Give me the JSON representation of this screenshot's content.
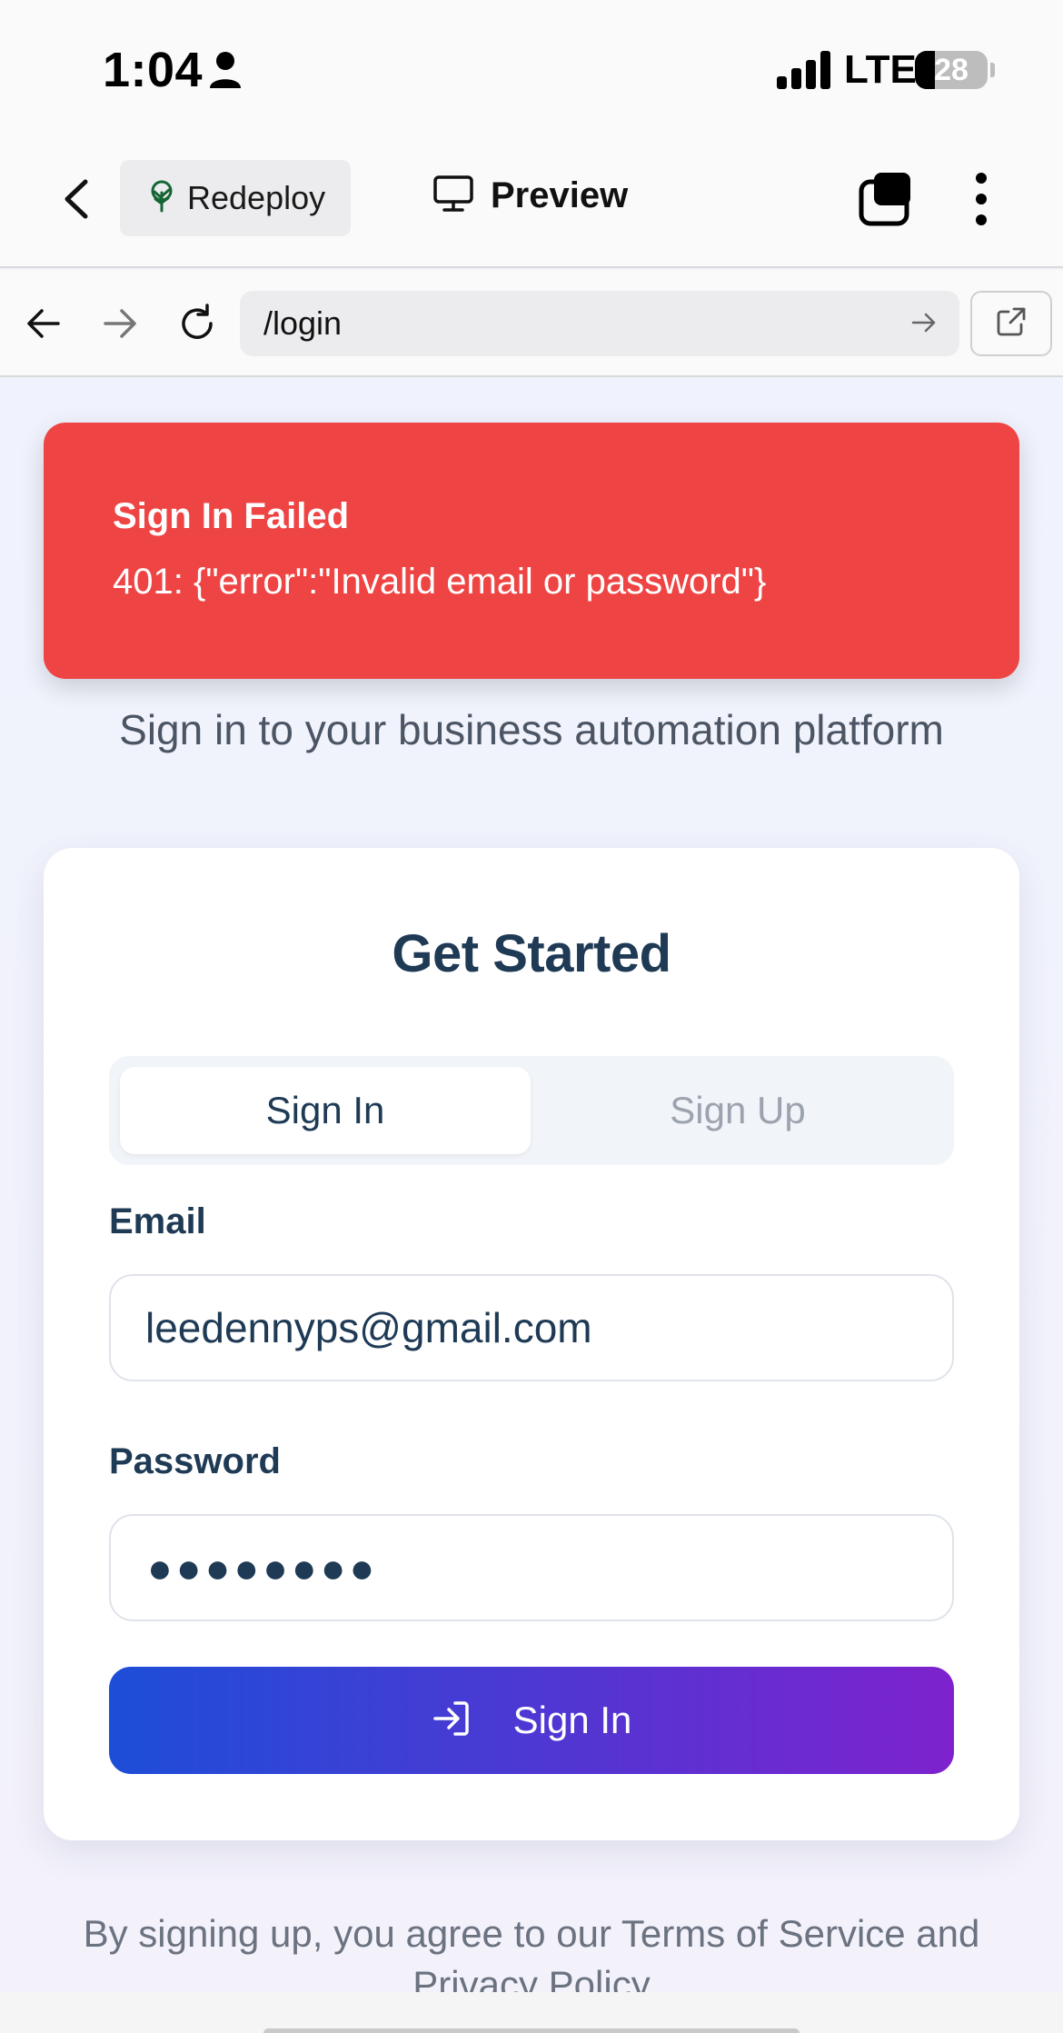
{
  "status_bar": {
    "time": "1:04",
    "network": "LTE",
    "battery": "28"
  },
  "header": {
    "redeploy_label": "Redeploy",
    "preview_label": "Preview"
  },
  "browser": {
    "url": "/login"
  },
  "toast": {
    "title": "Sign In Failed",
    "message": "401: {\"error\":\"Invalid email or password\"}"
  },
  "page": {
    "subtitle": "Sign in to your business automation platform",
    "card_title": "Get Started",
    "tabs": [
      {
        "label": "Sign In",
        "active": true
      },
      {
        "label": "Sign Up",
        "active": false
      }
    ],
    "email_label": "Email",
    "email_value": "leedennyps@gmail.com",
    "password_label": "Password",
    "password_masked": "●●●●●●●●",
    "submit_label": "Sign In",
    "terms_text": "By signing up, you agree to our Terms of Service and Privacy Policy"
  },
  "colors": {
    "error": "#ef4444",
    "heading": "#1e3a55",
    "button_gradient_start": "#1d4ed8",
    "button_gradient_end": "#7e22ce"
  },
  "icons": [
    "person-icon",
    "signal-icon",
    "battery-icon",
    "chevron-left-icon",
    "tree-icon",
    "monitor-icon",
    "tabs-icon",
    "more-vertical-icon",
    "arrow-left-icon",
    "arrow-right-icon",
    "reload-icon",
    "external-link-icon",
    "sign-in-icon"
  ]
}
